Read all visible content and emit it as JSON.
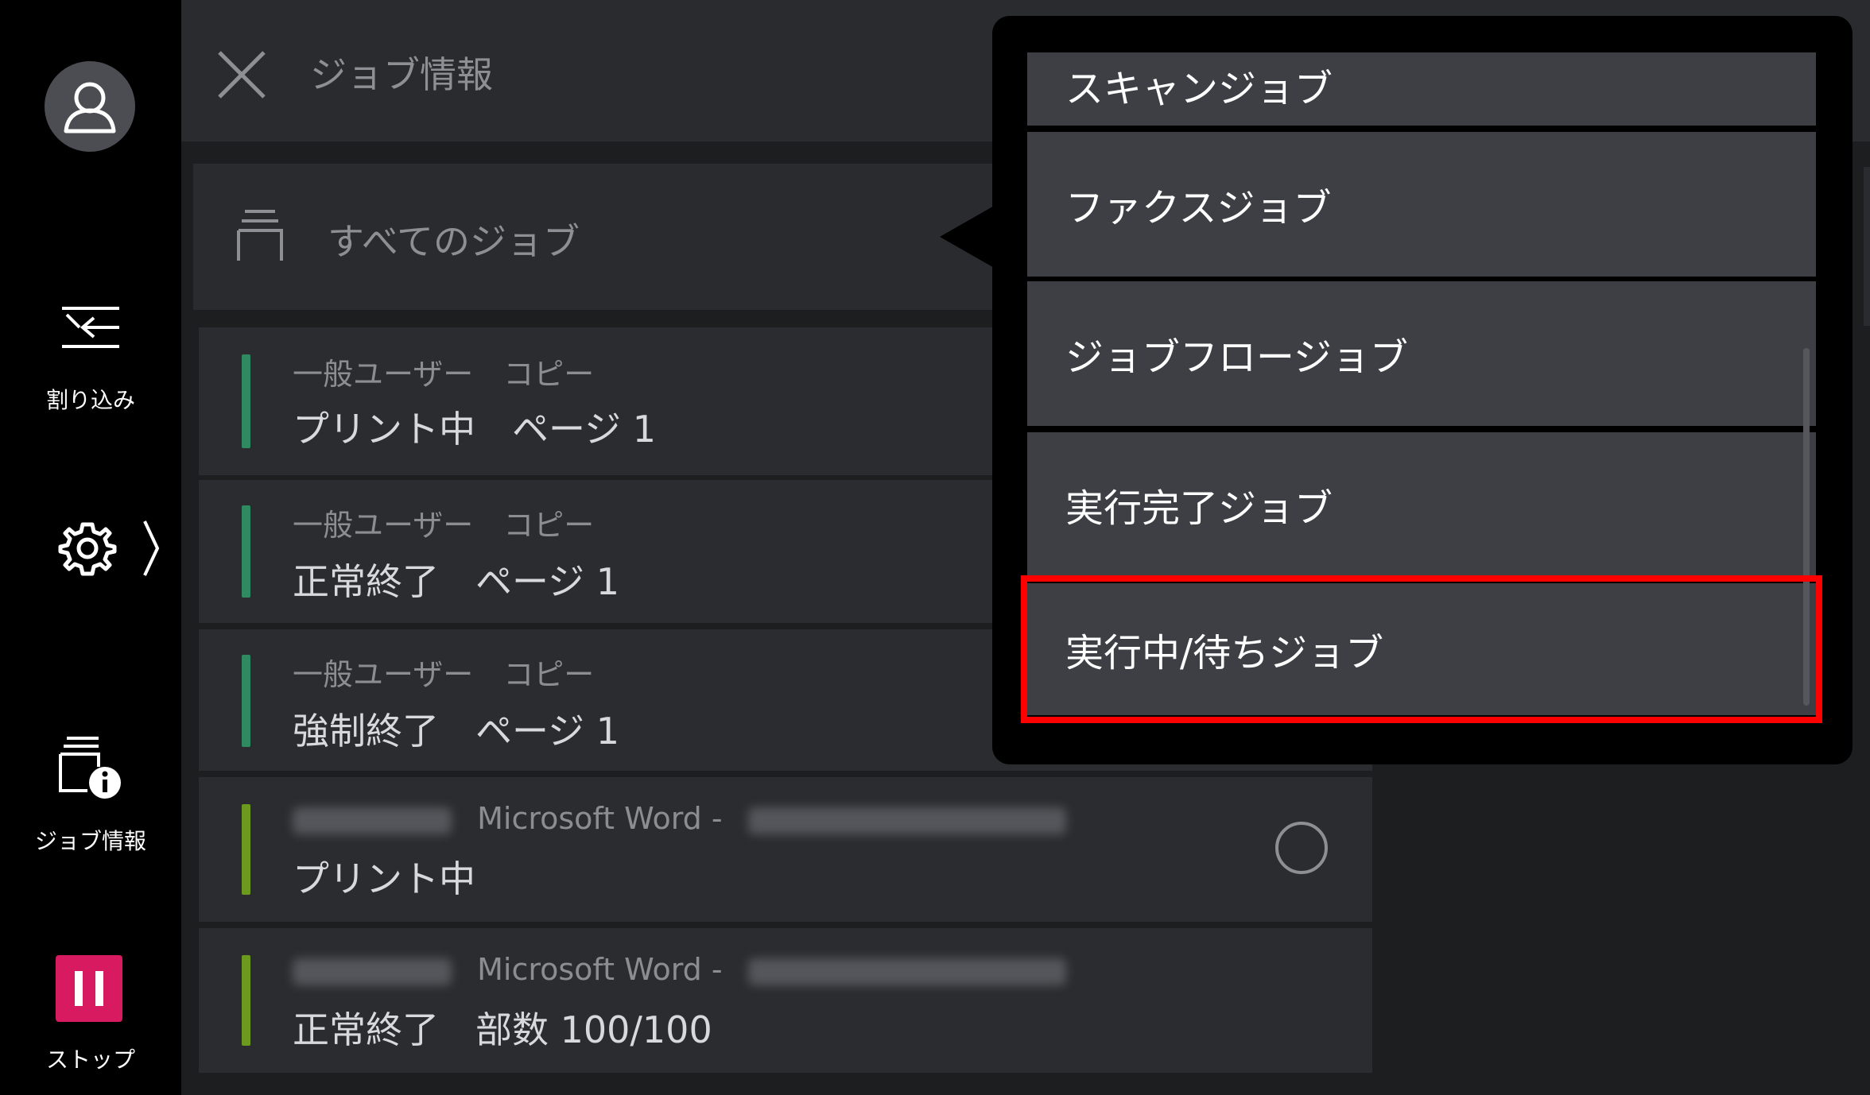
{
  "sidebar": {
    "interrupt_label": "割り込み",
    "job_info_label": "ジョブ情報",
    "stop_label": "ストップ"
  },
  "header": {
    "title": "ジョブ情報"
  },
  "filter": {
    "label": "すべてのジョブ"
  },
  "jobs": [
    {
      "line1": "一般ユーザー　コピー",
      "line2": "プリント中　ページ 1",
      "status_color": "#2f8a61"
    },
    {
      "line1": "一般ユーザー　コピー",
      "line2": "正常終了　ページ 1",
      "status_color": "#2f8a61"
    },
    {
      "line1": "一般ユーザー　コピー",
      "line2": "強制終了　ページ 1",
      "status_color": "#2f8a61"
    },
    {
      "line1": "Microsoft Word -",
      "line2": "プリント中",
      "status_color": "#6c9a1f"
    },
    {
      "line1": "Microsoft Word -",
      "line2": "正常終了　部数 100/100",
      "status_color": "#6c9a1f"
    }
  ],
  "dropdown": {
    "items": [
      {
        "label": "スキャンジョブ"
      },
      {
        "label": "ファクスジョブ"
      },
      {
        "label": "ジョブフロージョブ"
      },
      {
        "label": "実行完了ジョブ"
      },
      {
        "label": "実行中/待ちジョブ"
      }
    ],
    "highlighted_index": 4
  },
  "colors": {
    "stop_button": "#d81b60",
    "highlight": "#ff0000"
  }
}
